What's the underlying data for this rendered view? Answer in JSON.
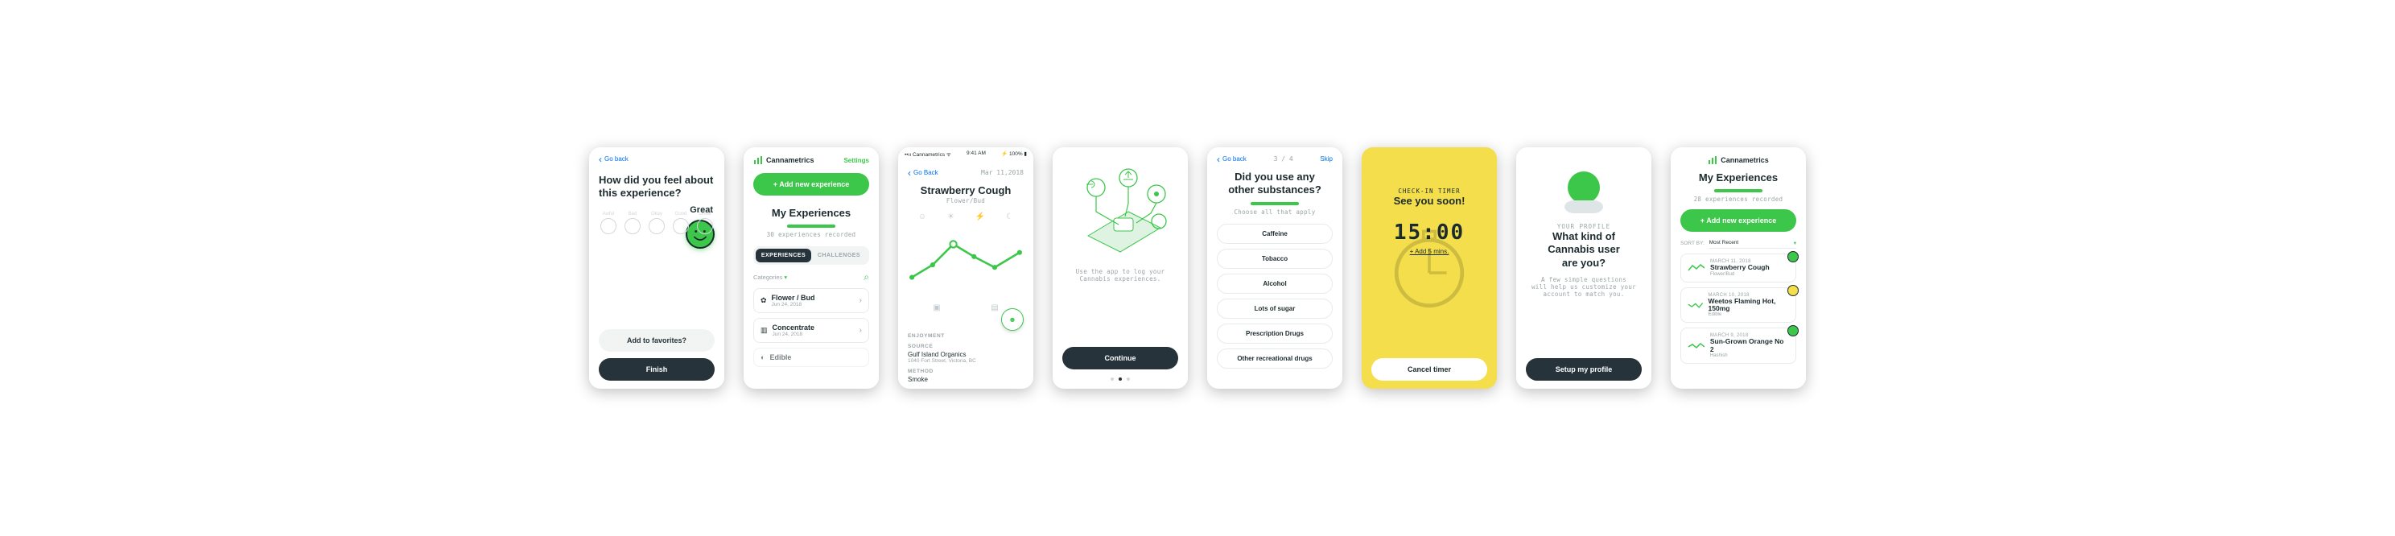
{
  "brand": "Cannametrics",
  "colors": {
    "accent": "#3cc74a",
    "dark": "#26333a",
    "yellow": "#f4de4c"
  },
  "screen1": {
    "back": "Go back",
    "question": "How did you feel about\nthis experience?",
    "selected_label": "Great",
    "scale": [
      "Awful",
      "Bad",
      "Okay",
      "Good",
      "Great"
    ],
    "favorites": "Add to favorites?",
    "finish": "Finish"
  },
  "screen2": {
    "settings": "Settings",
    "add": "+ Add new experience",
    "title": "My Experiences",
    "count_text": "30 experiences recorded",
    "tabs": {
      "experiences": "EXPERIENCES",
      "challenges": "CHALLENGES"
    },
    "categories_label": "Categories",
    "items": [
      {
        "name": "Flower / Bud",
        "date": "Jun 24, 2018"
      },
      {
        "name": "Concentrate",
        "date": "Jun 24, 2018"
      },
      {
        "name": "Edible",
        "date": ""
      }
    ]
  },
  "screen3": {
    "status_left": "Cannametrics",
    "status_time": "9:41 AM",
    "status_batt": "100%",
    "back": "Go Back",
    "date": "Mar 11,2018",
    "strain": "Strawberry Cough",
    "strain_sub": "Flower/Bud",
    "enjoyment_label": "ENJOYMENT",
    "source_label": "SOURCE",
    "source_name": "Gulf Island Organics",
    "source_addr": "1040 Fort Street, Victoria, BC",
    "method_label": "METHOD",
    "method_value": "Smoke"
  },
  "screen4": {
    "copy": "Use the app to log your\nCannabis experiences.",
    "cta": "Continue",
    "dot_active": 1,
    "dot_count": 3
  },
  "screen5": {
    "back": "Go back",
    "progress": "3 / 4",
    "skip": "Skip",
    "question": "Did you use any\nother substances?",
    "help": "Choose all that apply",
    "options": [
      "Caffeine",
      "Tobacco",
      "Alcohol",
      "Lots of sugar",
      "Prescription Drugs",
      "Other recreational drugs"
    ]
  },
  "screen6": {
    "label": "CHECK-IN TIMER",
    "headline": "See you soon!",
    "time": "15:00",
    "add": "+ Add 5 mins.",
    "cancel": "Cancel timer"
  },
  "screen7": {
    "section": "YOUR PROFILE",
    "question": "What kind of\nCannabis user\nare you?",
    "copy": "A few simple questions\nwill help us customize your\naccount to match you.",
    "cta": "Setup my profile"
  },
  "screen8": {
    "title": "My Experiences",
    "count_text": "28 experiences recorded",
    "add": "+ Add new experience",
    "sort_label": "SORT BY:",
    "sort_value": "Most Recent",
    "items": [
      {
        "date": "MARCH 11, 2018",
        "name": "Strawberry Cough",
        "type": "Flower/Bud",
        "mood": "green"
      },
      {
        "date": "MARCH 10, 2018",
        "name": "Weetos Flaming Hot, 150mg",
        "type": "Edible",
        "mood": "yellow"
      },
      {
        "date": "MARCH 9, 2018",
        "name": "Sun-Grown Orange No 2",
        "type": "Hashish",
        "mood": "green"
      }
    ]
  }
}
